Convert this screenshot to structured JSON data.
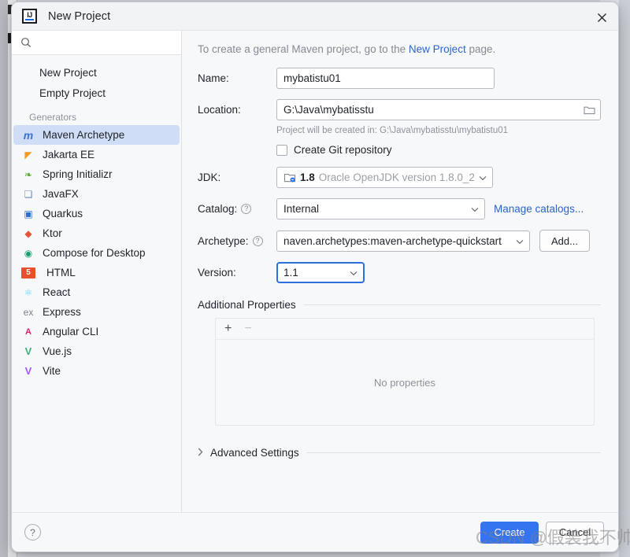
{
  "window": {
    "title": "New Project",
    "logo_text": "IJ",
    "close_icon": "close-icon"
  },
  "sidebar": {
    "search": {
      "value": "",
      "placeholder": ""
    },
    "top_items": [
      {
        "label": "New Project"
      },
      {
        "label": "Empty Project"
      }
    ],
    "section_label": "Generators",
    "generators": [
      {
        "label": "Maven Archetype",
        "icon": "maven-icon",
        "glyph": "m",
        "color": "#3a72d4",
        "selected": true
      },
      {
        "label": "Jakarta EE",
        "icon": "jakarta-ee-icon",
        "glyph": "◤",
        "color": "#f29b20",
        "selected": false
      },
      {
        "label": "Spring Initializr",
        "icon": "spring-icon",
        "glyph": "❧",
        "color": "#5aa53c",
        "selected": false
      },
      {
        "label": "JavaFX",
        "icon": "javafx-icon",
        "glyph": "❏",
        "color": "#6b86b8",
        "selected": false
      },
      {
        "label": "Quarkus",
        "icon": "quarkus-icon",
        "glyph": "▣",
        "color": "#2a6ed1",
        "selected": false
      },
      {
        "label": "Ktor",
        "icon": "ktor-icon",
        "glyph": "◆",
        "color": "#e2553b",
        "selected": false
      },
      {
        "label": "Compose for Desktop",
        "icon": "compose-icon",
        "glyph": "◉",
        "color": "#1a9e6f",
        "selected": false
      },
      {
        "label": "HTML",
        "icon": "html5-icon",
        "glyph": "5",
        "color": "#e8502b",
        "selected": false
      },
      {
        "label": "React",
        "icon": "react-icon",
        "glyph": "⚛",
        "color": "#61d6f2",
        "selected": false
      },
      {
        "label": "Express",
        "icon": "express-icon",
        "glyph": "ex",
        "color": "#7b8289",
        "selected": false
      },
      {
        "label": "Angular CLI",
        "icon": "angular-icon",
        "glyph": "A",
        "color": "#d6206e",
        "selected": false
      },
      {
        "label": "Vue.js",
        "icon": "vuejs-icon",
        "glyph": "V",
        "color": "#3fb27f",
        "selected": false
      },
      {
        "label": "Vite",
        "icon": "vite-icon",
        "glyph": "V",
        "color": "#a259ff",
        "selected": false
      }
    ]
  },
  "main": {
    "hint_before": "To create a general Maven project, go to the ",
    "hint_link": "New Project",
    "hint_after": " page.",
    "name": {
      "label": "Name:",
      "value": "mybatistu01"
    },
    "location": {
      "label": "Location:",
      "value": "G:\\Java\\mybatisstu",
      "browse_icon": "folder-icon",
      "note": "Project will be created in: G:\\Java\\mybatisstu\\mybatistu01"
    },
    "git": {
      "label": "Create Git repository",
      "checked": false
    },
    "jdk": {
      "label": "JDK:",
      "version": "1.8",
      "description": "Oracle OpenJDK version 1.8.0_2(",
      "icon": "jdk-icon"
    },
    "catalog": {
      "label": "Catalog:",
      "value": "Internal",
      "manage_link": "Manage catalogs...",
      "help_icon": "help-icon"
    },
    "archetype": {
      "label": "Archetype:",
      "value": "naven.archetypes:maven-archetype-quickstart",
      "add_button": "Add...",
      "help_icon": "help-icon"
    },
    "version": {
      "label": "Version:",
      "value": "1.1",
      "focused": true
    },
    "additional_properties": {
      "title": "Additional Properties",
      "add_icon": "plus-icon",
      "remove_icon": "minus-icon",
      "empty_text": "No properties"
    },
    "advanced_settings": {
      "label": "Advanced Settings",
      "expand_icon": "chevron-right-icon"
    }
  },
  "footer": {
    "help_icon": "question-mark-icon",
    "create_label": "Create",
    "cancel_label": "Cancel"
  },
  "watermark": {
    "text": "CSDN @假装我不帅"
  },
  "colors": {
    "accent": "#3574f0",
    "link": "#2b65c8",
    "selection": "#cfddf7",
    "focus_ring": "#2d6fdb",
    "dialog_bg": "#f7f8fa"
  }
}
